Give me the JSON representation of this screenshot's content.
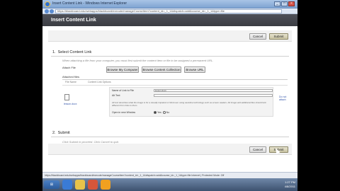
{
  "window": {
    "title": "Insert Content Link - Windows Internet Explorer",
    "address": "https://blackboard.edu/webapps/blackboard/execute/manageCourseItem?content_id=_1_1&dispatch=add&course_id=_1_1&type=file"
  },
  "page": {
    "header": "Insert Content Link",
    "cancel_label": "Cancel",
    "submit_label": "Submit"
  },
  "section1": {
    "number": "1.",
    "title": "Select Content Link",
    "description": "When attaching a file from your computer, you must first submit the content item or file to be assigned a permanent URL.",
    "attach_file_label": "Attach File",
    "browse_computer": "Browse My Computer",
    "browse_collection": "Browse Content Collection",
    "browse_url": "Browse URL",
    "attached_files_label": "Attached files",
    "col_file_name": "File Name",
    "col_link_options": "Content Link Options",
    "file_name": "lesson.docx",
    "name_of_link_label": "Name of Link to File",
    "name_of_link_value": "lesson.docx",
    "alt_text_label": "Alt Text",
    "alt_text_value": "",
    "note": "Alt text describes what the image is for a visually impaired or blind user using assistive technology such as screen readers. Alt Image and additional files should look different from links to them.",
    "open_new_window_label": "Open in new Window",
    "yes": "Yes",
    "no": "No",
    "do_not_attach": "Do not attach"
  },
  "section2": {
    "number": "2.",
    "title": "Submit",
    "description": "Click Submit to proceed. Click Cancel to quit.",
    "cancel_label": "Cancel",
    "submit_label": "Submit"
  },
  "statusbar": {
    "text": "https://blackboard.edu/webapps/blackboard/execute/manageCourseItem?content_id=_1_1&dispatch=add&course_id=_1_1&type=file  Internet | Protected Mode: Off"
  },
  "taskbar": {
    "start": "⊞",
    "time": "1:27 PM",
    "date": "4/8/2011"
  },
  "colors": {
    "header_bg": "#45474d",
    "primary_button": "#c9c4a3",
    "link": "#3355aa"
  }
}
